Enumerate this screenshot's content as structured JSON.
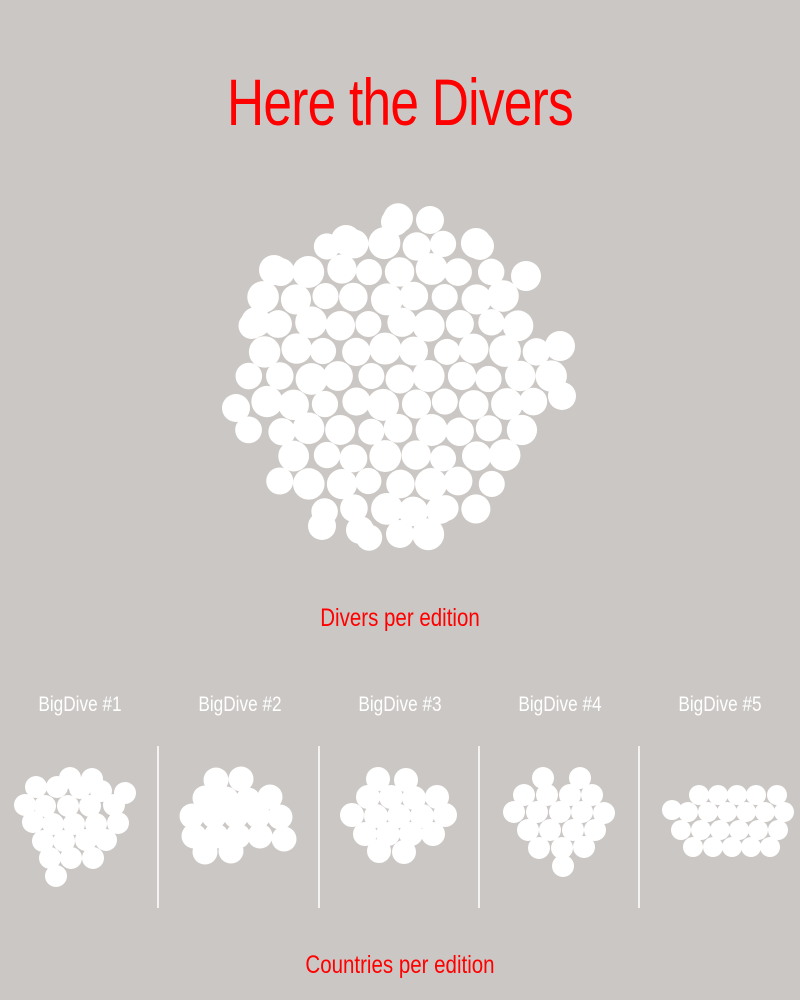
{
  "page": {
    "title": "Here the Divers",
    "divers_label": "Divers per edition",
    "countries_label": "Countries per edition"
  },
  "colors": {
    "background": "#cbc7c4",
    "accent": "#ff0000",
    "bubble": "#ffffff",
    "divider": "#f4f3f1"
  },
  "editions": [
    {
      "label": "BigDive #1"
    },
    {
      "label": "BigDive #2"
    },
    {
      "label": "BigDive #3"
    },
    {
      "label": "BigDive #4"
    },
    {
      "label": "BigDive #5"
    }
  ]
}
